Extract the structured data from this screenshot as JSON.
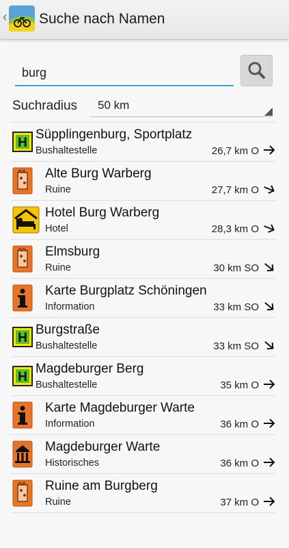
{
  "header": {
    "title": "Suche nach Namen"
  },
  "search": {
    "value": "burg"
  },
  "radius": {
    "label": "Suchradius",
    "value": "50 km"
  },
  "results": [
    {
      "name": "Süpplingenburg, Sportplatz",
      "category": "Bushaltestelle",
      "distance": "26,7 km O",
      "icon": "bus-stop-icon",
      "direction": "east"
    },
    {
      "name": "Alte Burg Warberg",
      "category": "Ruine",
      "distance": "27,7 km O",
      "icon": "ruin-icon",
      "direction": "east-southeast"
    },
    {
      "name": "Hotel Burg Warberg",
      "category": "Hotel",
      "distance": "28,3 km O",
      "icon": "hotel-icon",
      "direction": "east-southeast"
    },
    {
      "name": "Elmsburg",
      "category": "Ruine",
      "distance": "30 km SO",
      "icon": "ruin-icon",
      "direction": "southeast"
    },
    {
      "name": "Karte Burgplatz Schöningen",
      "category": "Information",
      "distance": "33 km SO",
      "icon": "information-icon",
      "direction": "southeast"
    },
    {
      "name": "Burgstraße",
      "category": "Bushaltestelle",
      "distance": "33 km SO",
      "icon": "bus-stop-icon",
      "direction": "southeast"
    },
    {
      "name": "Magdeburger Berg",
      "category": "Bushaltestelle",
      "distance": "35 km O",
      "icon": "bus-stop-icon",
      "direction": "east"
    },
    {
      "name": "Karte Magdeburger Warte",
      "category": "Information",
      "distance": "36 km O",
      "icon": "information-icon",
      "direction": "east"
    },
    {
      "name": "Magdeburger Warte",
      "category": "Historisches",
      "distance": "36 km O",
      "icon": "historic-icon",
      "direction": "east"
    },
    {
      "name": "Ruine am Burgberg",
      "category": "Ruine",
      "distance": "37 km O",
      "icon": "ruin-icon",
      "direction": "east"
    }
  ],
  "colors": {
    "accent": "#3aa6c9",
    "bus_green": "#5bbf2a",
    "poi_orange": "#e8742a",
    "hotel_yellow": "#f6c400"
  }
}
